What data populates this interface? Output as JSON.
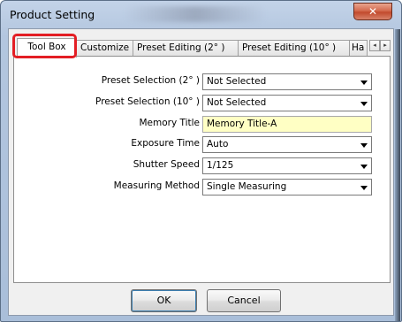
{
  "window": {
    "title": "Product Setting",
    "close_glyph": "✕"
  },
  "tabs": [
    {
      "label": "Tool Box"
    },
    {
      "label": "Customize"
    },
    {
      "label": "Preset Editing (2° )"
    },
    {
      "label": "Preset Editing (10° )"
    },
    {
      "label": "Ha"
    }
  ],
  "tab_scroll": {
    "left": "◂",
    "right": "▸"
  },
  "form": {
    "preset_selection_2": {
      "label": "Preset Selection (2° )",
      "value": "Not Selected"
    },
    "preset_selection_10": {
      "label": "Preset Selection (10° )",
      "value": "Not Selected"
    },
    "memory_title": {
      "label": "Memory Title",
      "value": "Memory Title-A"
    },
    "exposure_time": {
      "label": "Exposure Time",
      "value": "Auto"
    },
    "shutter_speed": {
      "label": "Shutter Speed",
      "value": "1/125"
    },
    "measuring_method": {
      "label": "Measuring Method",
      "value": "Single Measuring"
    }
  },
  "buttons": {
    "ok": "OK",
    "cancel": "Cancel"
  },
  "colors": {
    "highlight": "#e31e24",
    "memory_title_bg": "#ffffc4",
    "close_button": "#c9553a"
  }
}
